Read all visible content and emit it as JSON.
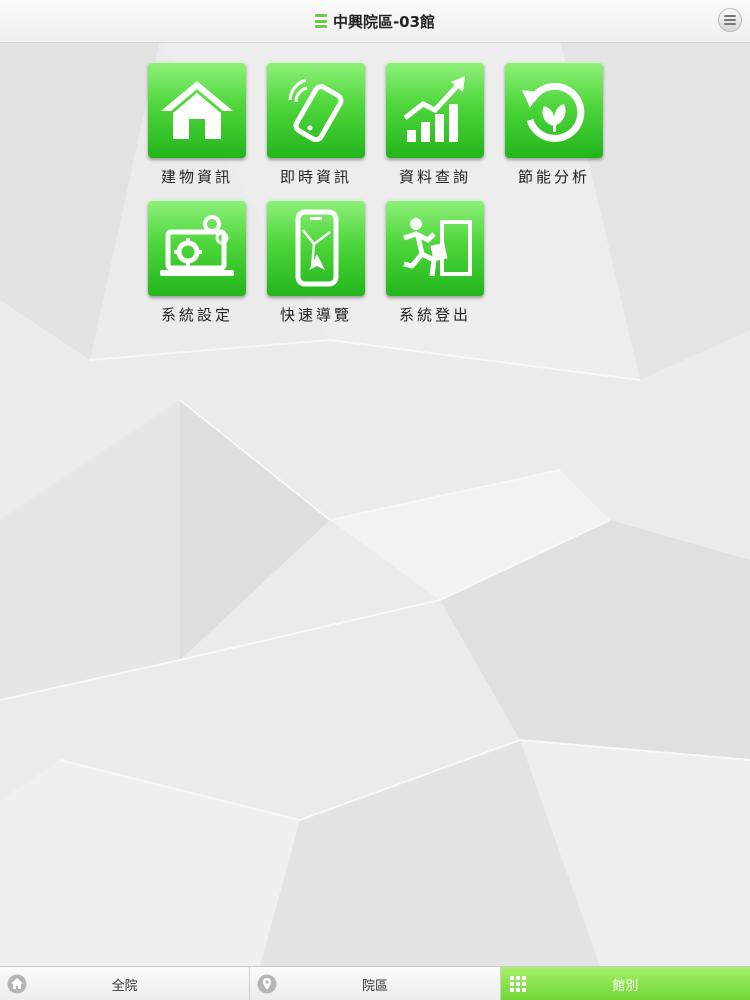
{
  "header": {
    "title": "中興院區-03館",
    "menu_icon": "menu-icon"
  },
  "tiles": [
    {
      "label": "建物資訊",
      "icon": "house-icon"
    },
    {
      "label": "即時資訊",
      "icon": "phone-vibrate-icon"
    },
    {
      "label": "資料查詢",
      "icon": "bar-chart-up-icon"
    },
    {
      "label": "節能分析",
      "icon": "leaf-cycle-icon"
    },
    {
      "label": "系統設定",
      "icon": "laptop-gear-icon"
    },
    {
      "label": "快速導覽",
      "icon": "phone-map-icon"
    },
    {
      "label": "系統登出",
      "icon": "running-man-exit-icon"
    }
  ],
  "tabbar": {
    "tabs": [
      {
        "label": "全院",
        "icon": "home-icon",
        "active": false
      },
      {
        "label": "院區",
        "icon": "location-pin-icon",
        "active": false
      },
      {
        "label": "館別",
        "icon": "grid-icon",
        "active": true
      }
    ]
  },
  "colors": {
    "accent_green": "#4fd63c",
    "tab_active": "#8be24f"
  }
}
